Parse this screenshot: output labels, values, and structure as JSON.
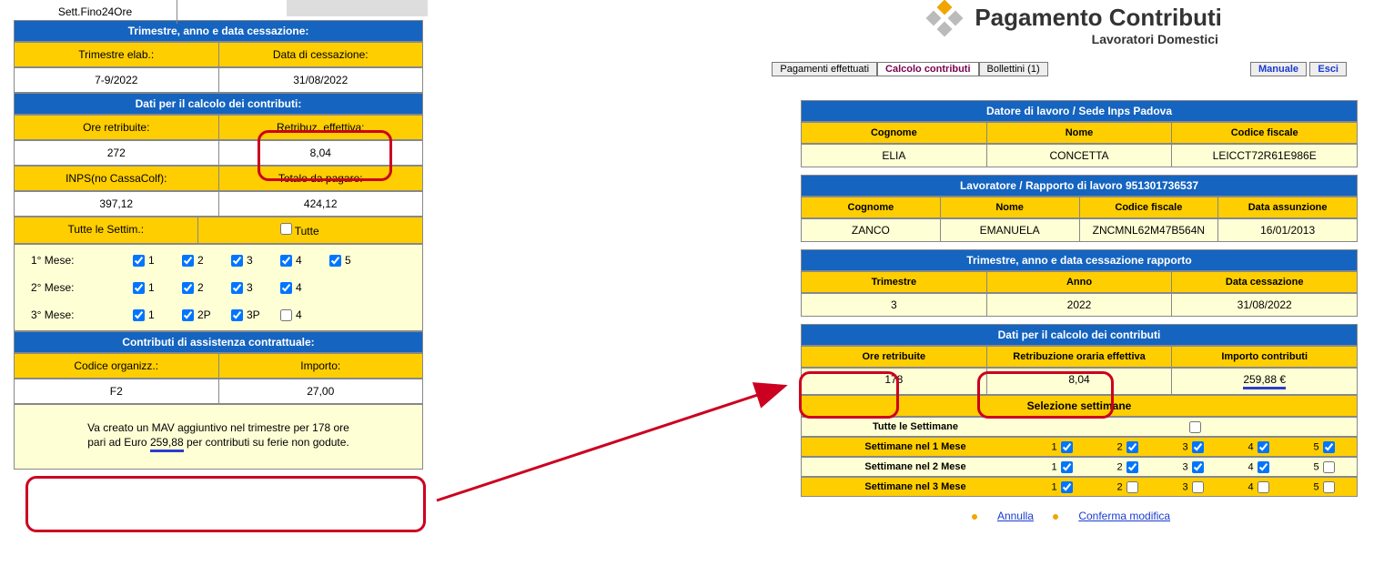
{
  "left": {
    "topLabel": "Sett.Fino24Ore",
    "sec1Header": "Trimestre, anno e data cessazione:",
    "trimElabLbl": "Trimestre elab.:",
    "trimElabVal": "7-9/2022",
    "dataCessLbl": "Data di cessazione:",
    "dataCessVal": "31/08/2022",
    "sec2Header": "Dati per il calcolo dei contributi:",
    "oreLbl": "Ore retribuite:",
    "oreVal": "272",
    "retribLbl": "Retribuz. effettiva:",
    "retribVal": "8,04",
    "inpsLbl": "INPS(no CassaColf):",
    "inpsVal": "397,12",
    "totaleLbl": "Totale da pagare:",
    "totaleVal": "424,12",
    "tutteLbl": "Tutte le Settim.:",
    "tutteChk": "Tutte",
    "mese1": "1° Mese:",
    "mese2": "2° Mese:",
    "mese3": "3° Mese:",
    "m1": [
      "1",
      "2",
      "3",
      "4",
      "5"
    ],
    "m2": [
      "1",
      "2",
      "3",
      "4"
    ],
    "m3": [
      "1",
      "2P",
      "3P",
      "4"
    ],
    "sec3Header": "Contributi di assistenza contrattuale:",
    "codOrgLbl": "Codice organizz.:",
    "codOrgVal": "F2",
    "importoLbl": "Importo:",
    "importoVal": "27,00",
    "notice1": "Va creato un MAV aggiuntivo nel trimestre per 178 ore",
    "notice2a": "pari ad Euro ",
    "notice2b": "259,88",
    "notice2c": " per contributi su ferie non godute."
  },
  "right": {
    "logoTitle": "Pagamento Contributi",
    "logoSub": "Lavoratori Domestici",
    "tabs": [
      "Pagamenti effettuati",
      "Calcolo contributi",
      "Bollettini (1)"
    ],
    "sideLinks": [
      "Manuale",
      "Esci"
    ],
    "datoreHeader": "Datore di lavoro / Sede Inps Padova",
    "datoreCols": [
      "Cognome",
      "Nome",
      "Codice fiscale"
    ],
    "datoreVals": [
      "ELIA",
      "CONCETTA",
      "LEICCT72R61E986E"
    ],
    "lavHeader": "Lavoratore / Rapporto di lavoro 951301736537",
    "lavCols": [
      "Cognome",
      "Nome",
      "Codice fiscale",
      "Data assunzione"
    ],
    "lavVals": [
      "ZANCO",
      "EMANUELA",
      "ZNCMNL62M47B564N",
      "16/01/2013"
    ],
    "trimHeader": "Trimestre, anno e data cessazione rapporto",
    "trimCols": [
      "Trimestre",
      "Anno",
      "Data cessazione"
    ],
    "trimVals": [
      "3",
      "2022",
      "31/08/2022"
    ],
    "calcHeader": "Dati per il calcolo dei contributi",
    "calcCols": [
      "Ore retribuite",
      "Retribuzione oraria effettiva",
      "Importo contributi"
    ],
    "calcVals": [
      "178",
      "8,04",
      "259,88 €"
    ],
    "selHeader": "Selezione settimane",
    "selTutte": "Tutte le Settimane",
    "selM1": "Settimane nel 1 Mese",
    "selM2": "Settimane nel 2 Mese",
    "selM3": "Settimane nel 3 Mese",
    "wk": [
      "1",
      "2",
      "3",
      "4",
      "5"
    ],
    "annulla": "Annulla",
    "conferma": "Conferma modifica"
  }
}
